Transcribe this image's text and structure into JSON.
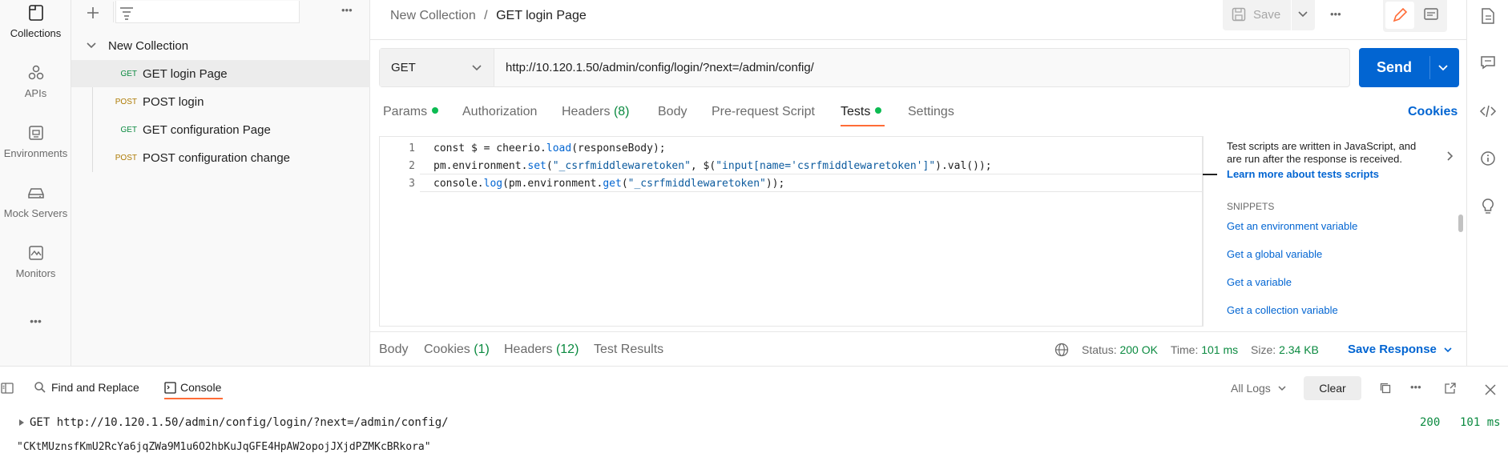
{
  "rail": {
    "items": [
      {
        "label": "Collections",
        "icon": "collections-icon"
      },
      {
        "label": "APIs",
        "icon": "apis-icon"
      },
      {
        "label": "Environments",
        "icon": "environments-icon"
      },
      {
        "label": "Mock Servers",
        "icon": "mock-servers-icon"
      },
      {
        "label": "Monitors",
        "icon": "monitors-icon"
      }
    ],
    "more": "•••"
  },
  "sidebar": {
    "more": "•••",
    "collection_name": "New Collection",
    "requests": [
      {
        "method": "GET",
        "name": "GET login Page"
      },
      {
        "method": "POST",
        "name": "POST login"
      },
      {
        "method": "GET",
        "name": "GET configuration Page"
      },
      {
        "method": "POST",
        "name": "POST configuration change"
      }
    ]
  },
  "header": {
    "breadcrumb_parent": "New Collection",
    "separator": "/",
    "breadcrumb_current": "GET login Page",
    "save_label": "Save",
    "more": "•••"
  },
  "request": {
    "method": "GET",
    "url": "http://10.120.1.50/admin/config/login/?next=/admin/config/",
    "send_label": "Send"
  },
  "tabs": {
    "params": "Params",
    "authorization": "Authorization",
    "headers": "Headers",
    "headers_count": "(8)",
    "body": "Body",
    "prerequest": "Pre-request Script",
    "tests": "Tests",
    "settings": "Settings",
    "cookies": "Cookies"
  },
  "editor": {
    "line_numbers": [
      "1",
      "2",
      "3"
    ],
    "line1_a": "const $ = cheerio.",
    "line1_b": "load",
    "line1_c": "(responseBody);",
    "line2_a": "pm.environment.",
    "line2_b": "set",
    "line2_c": "(",
    "line2_d": "\"_csrfmiddlewaretoken\"",
    "line2_e": ", $(",
    "line2_f": "\"input[name='csrfmiddlewaretoken']\"",
    "line2_g": ").val());",
    "line3_a": "console.",
    "line3_b": "log",
    "line3_c": "(pm.environment.",
    "line3_d": "get",
    "line3_e": "(",
    "line3_f": "\"_csrfmiddlewaretoken\"",
    "line3_g": "));"
  },
  "help": {
    "line1": "Test scripts are written in JavaScript, and",
    "line2": "are run after the response is received.",
    "learn_more": "Learn more about tests scripts",
    "snippets_heading": "SNIPPETS",
    "snippets": [
      "Get an environment variable",
      "Get a global variable",
      "Get a variable",
      "Get a collection variable"
    ]
  },
  "response": {
    "body": "Body",
    "cookies": "Cookies",
    "cookies_count": "(1)",
    "headers": "Headers",
    "headers_count": "(12)",
    "test_results": "Test Results",
    "status_label": "Status:",
    "status_value": "200 OK",
    "time_label": "Time:",
    "time_value": "101 ms",
    "size_label": "Size:",
    "size_value": "2.34 KB",
    "save_response": "Save Response"
  },
  "console": {
    "find_replace": "Find and Replace",
    "console_tab": "Console",
    "log_filter": "All Logs",
    "clear": "Clear",
    "entry_request": "GET http://10.120.1.50/admin/config/login/?next=/admin/config/",
    "entry_status": "200",
    "entry_time": "101 ms",
    "entry_value": "\"CKtMUznsfKmU2RcYa6jqZWa9M1u6O2hbKuJqGFE4HpAW2opojJXjdPZMKcBRkora\""
  },
  "colors": {
    "accent": "#ff6c37",
    "send": "#0265d2",
    "get": "#0b8a40",
    "post": "#ad7a03",
    "dot": "#0cbb52"
  }
}
